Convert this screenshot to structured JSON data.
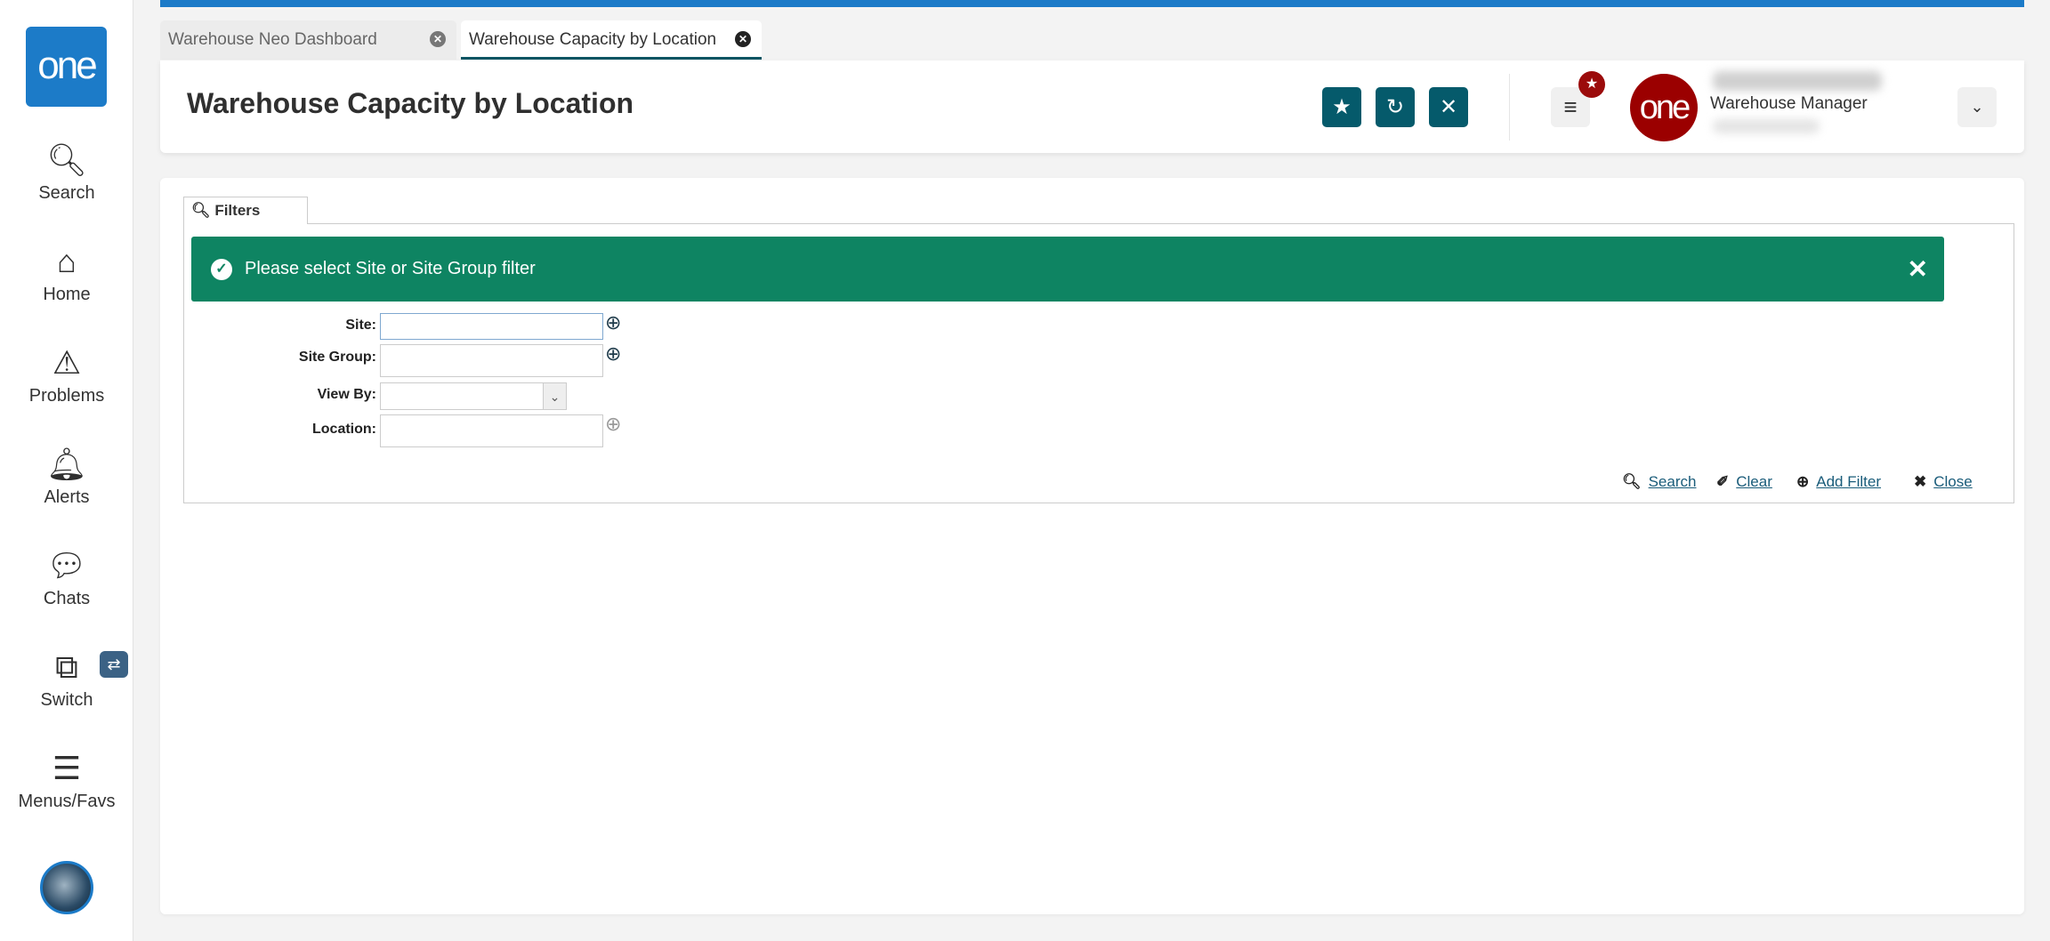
{
  "sidebar": {
    "logo": "one",
    "items": [
      {
        "label": "Search",
        "icon": "search-icon"
      },
      {
        "label": "Home",
        "icon": "home-icon"
      },
      {
        "label": "Problems",
        "icon": "warning-icon"
      },
      {
        "label": "Alerts",
        "icon": "bell-icon"
      },
      {
        "label": "Chats",
        "icon": "chat-icon"
      },
      {
        "label": "Switch",
        "icon": "switch-icon"
      },
      {
        "label": "Menus/Favs",
        "icon": "menu-icon"
      }
    ]
  },
  "tabs": [
    {
      "label": "Warehouse Neo Dashboard",
      "active": false
    },
    {
      "label": "Warehouse Capacity by Location",
      "active": true
    }
  ],
  "header": {
    "title": "Warehouse Capacity by Location",
    "user_logo": "one",
    "role": "Warehouse Manager"
  },
  "filters": {
    "tab_label": "Filters",
    "alert": "Please select Site or Site Group filter",
    "fields": [
      {
        "label": "Site:",
        "value": ""
      },
      {
        "label": "Site Group:",
        "value": ""
      },
      {
        "label": "View By:",
        "value": ""
      },
      {
        "label": "Location:",
        "value": ""
      }
    ],
    "actions": {
      "search": "Search",
      "clear": "Clear",
      "add_filter": "Add Filter",
      "close": "Close"
    }
  },
  "colors": {
    "brand": "#1c7bc8",
    "header_buttons": "#055a6b",
    "alert": "#0e8462",
    "user_logo": "#9b0000"
  }
}
